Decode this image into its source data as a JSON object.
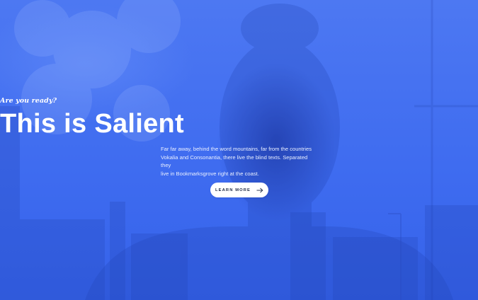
{
  "hero": {
    "kicker": "Are you ready?",
    "title": "This is Salient",
    "description_lines": [
      "Far far away, behind the word mountains, far from the countries",
      "Vokalia and Consonantia, there live the blind texts. Separated they",
      "live in Bookmarksgrove right at the coast."
    ],
    "cta_label": "LEARN MORE",
    "cta_icon": "arrow-right-icon",
    "overlay_color": "#4a74f0"
  }
}
